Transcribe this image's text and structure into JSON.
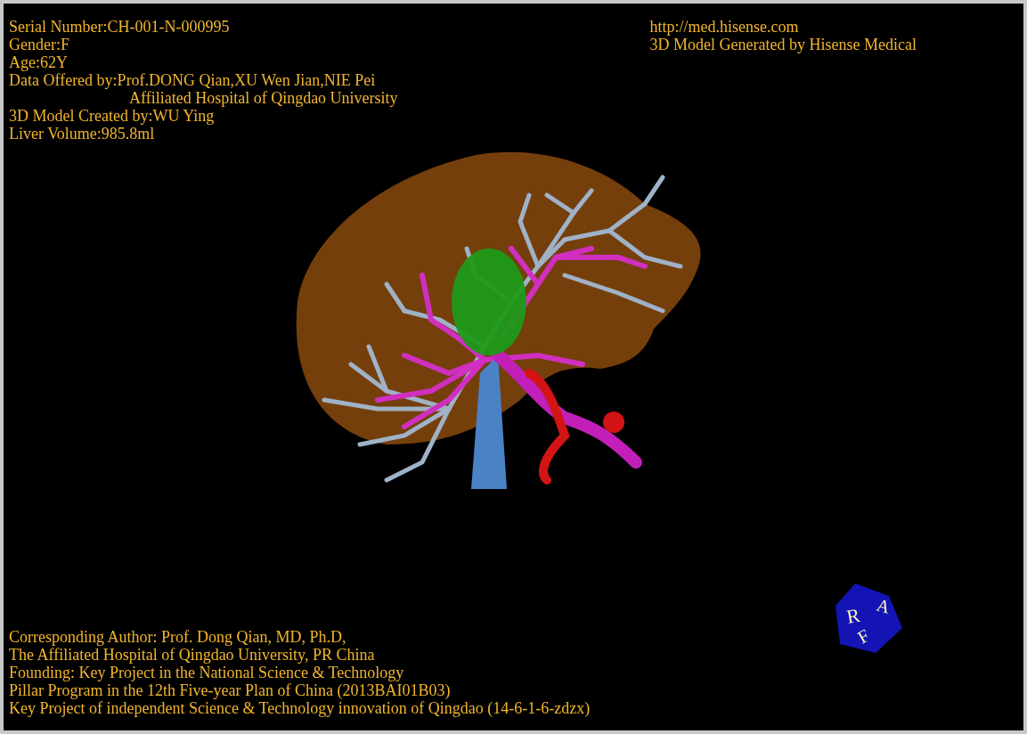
{
  "patient_info": [
    {
      "kind": "line",
      "text": "Serial Number:CH-001-N-000995"
    },
    {
      "kind": "line",
      "text": "Gender:F"
    },
    {
      "kind": "line",
      "text": "Age:62Y"
    },
    {
      "kind": "line",
      "text": "Data Offered by:Prof.DONG Qian,XU Wen Jian,NIE Pei"
    },
    {
      "kind": "continuation",
      "text": "Affiliated Hospital of Qingdao University"
    },
    {
      "kind": "line",
      "text": "3D Model Created by:WU Ying"
    },
    {
      "kind": "line",
      "text": "Liver Volume:985.8ml"
    }
  ],
  "source_info": [
    "http://med.hisense.com",
    "3D Model Generated by Hisense Medical"
  ],
  "credits": [
    "Corresponding Author: Prof. Dong Qian, MD, Ph.D,",
    "The Affiliated Hospital of Qingdao University, PR China",
    "Founding: Key Project in the National Science & Technology",
    "Pillar Program in the 12th Five-year Plan of China (2013BAI01B03)",
    "Key Project of independent Science & Technology innovation of Qingdao (14-6-1-6-zdzx)"
  ],
  "orientation_cube": {
    "left_face": "R",
    "top_face": "A",
    "front_face": "F"
  }
}
